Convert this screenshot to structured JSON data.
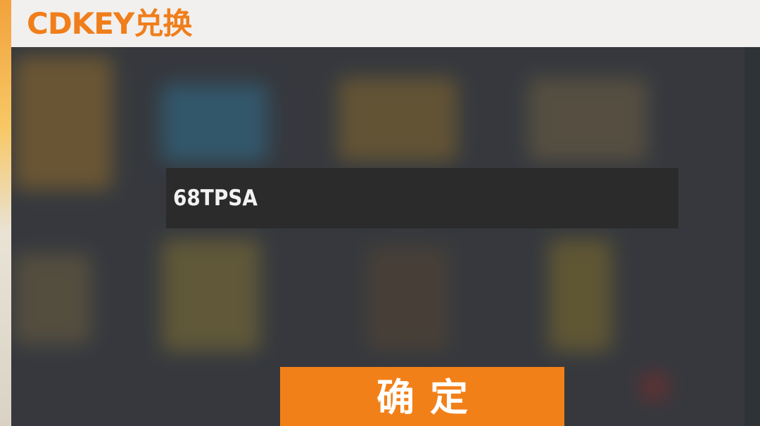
{
  "header": {
    "title": "CDKEY兑换"
  },
  "cdkey_input": {
    "value": "68TPSA",
    "placeholder": ""
  },
  "confirm_button": {
    "label": "确定"
  },
  "colors": {
    "accent": "#f07e1b",
    "button": "#f28019",
    "header_bg": "#f1f0ee",
    "input_bg": "#2b2b2b",
    "overlay_bg": "#474b52"
  },
  "background_icons": [
    "frame-icon",
    "basket-icon",
    "sword-icon",
    "book-icon",
    "bow-icon",
    "pencil-icon",
    "backpack-icon",
    "bottle-icon"
  ]
}
